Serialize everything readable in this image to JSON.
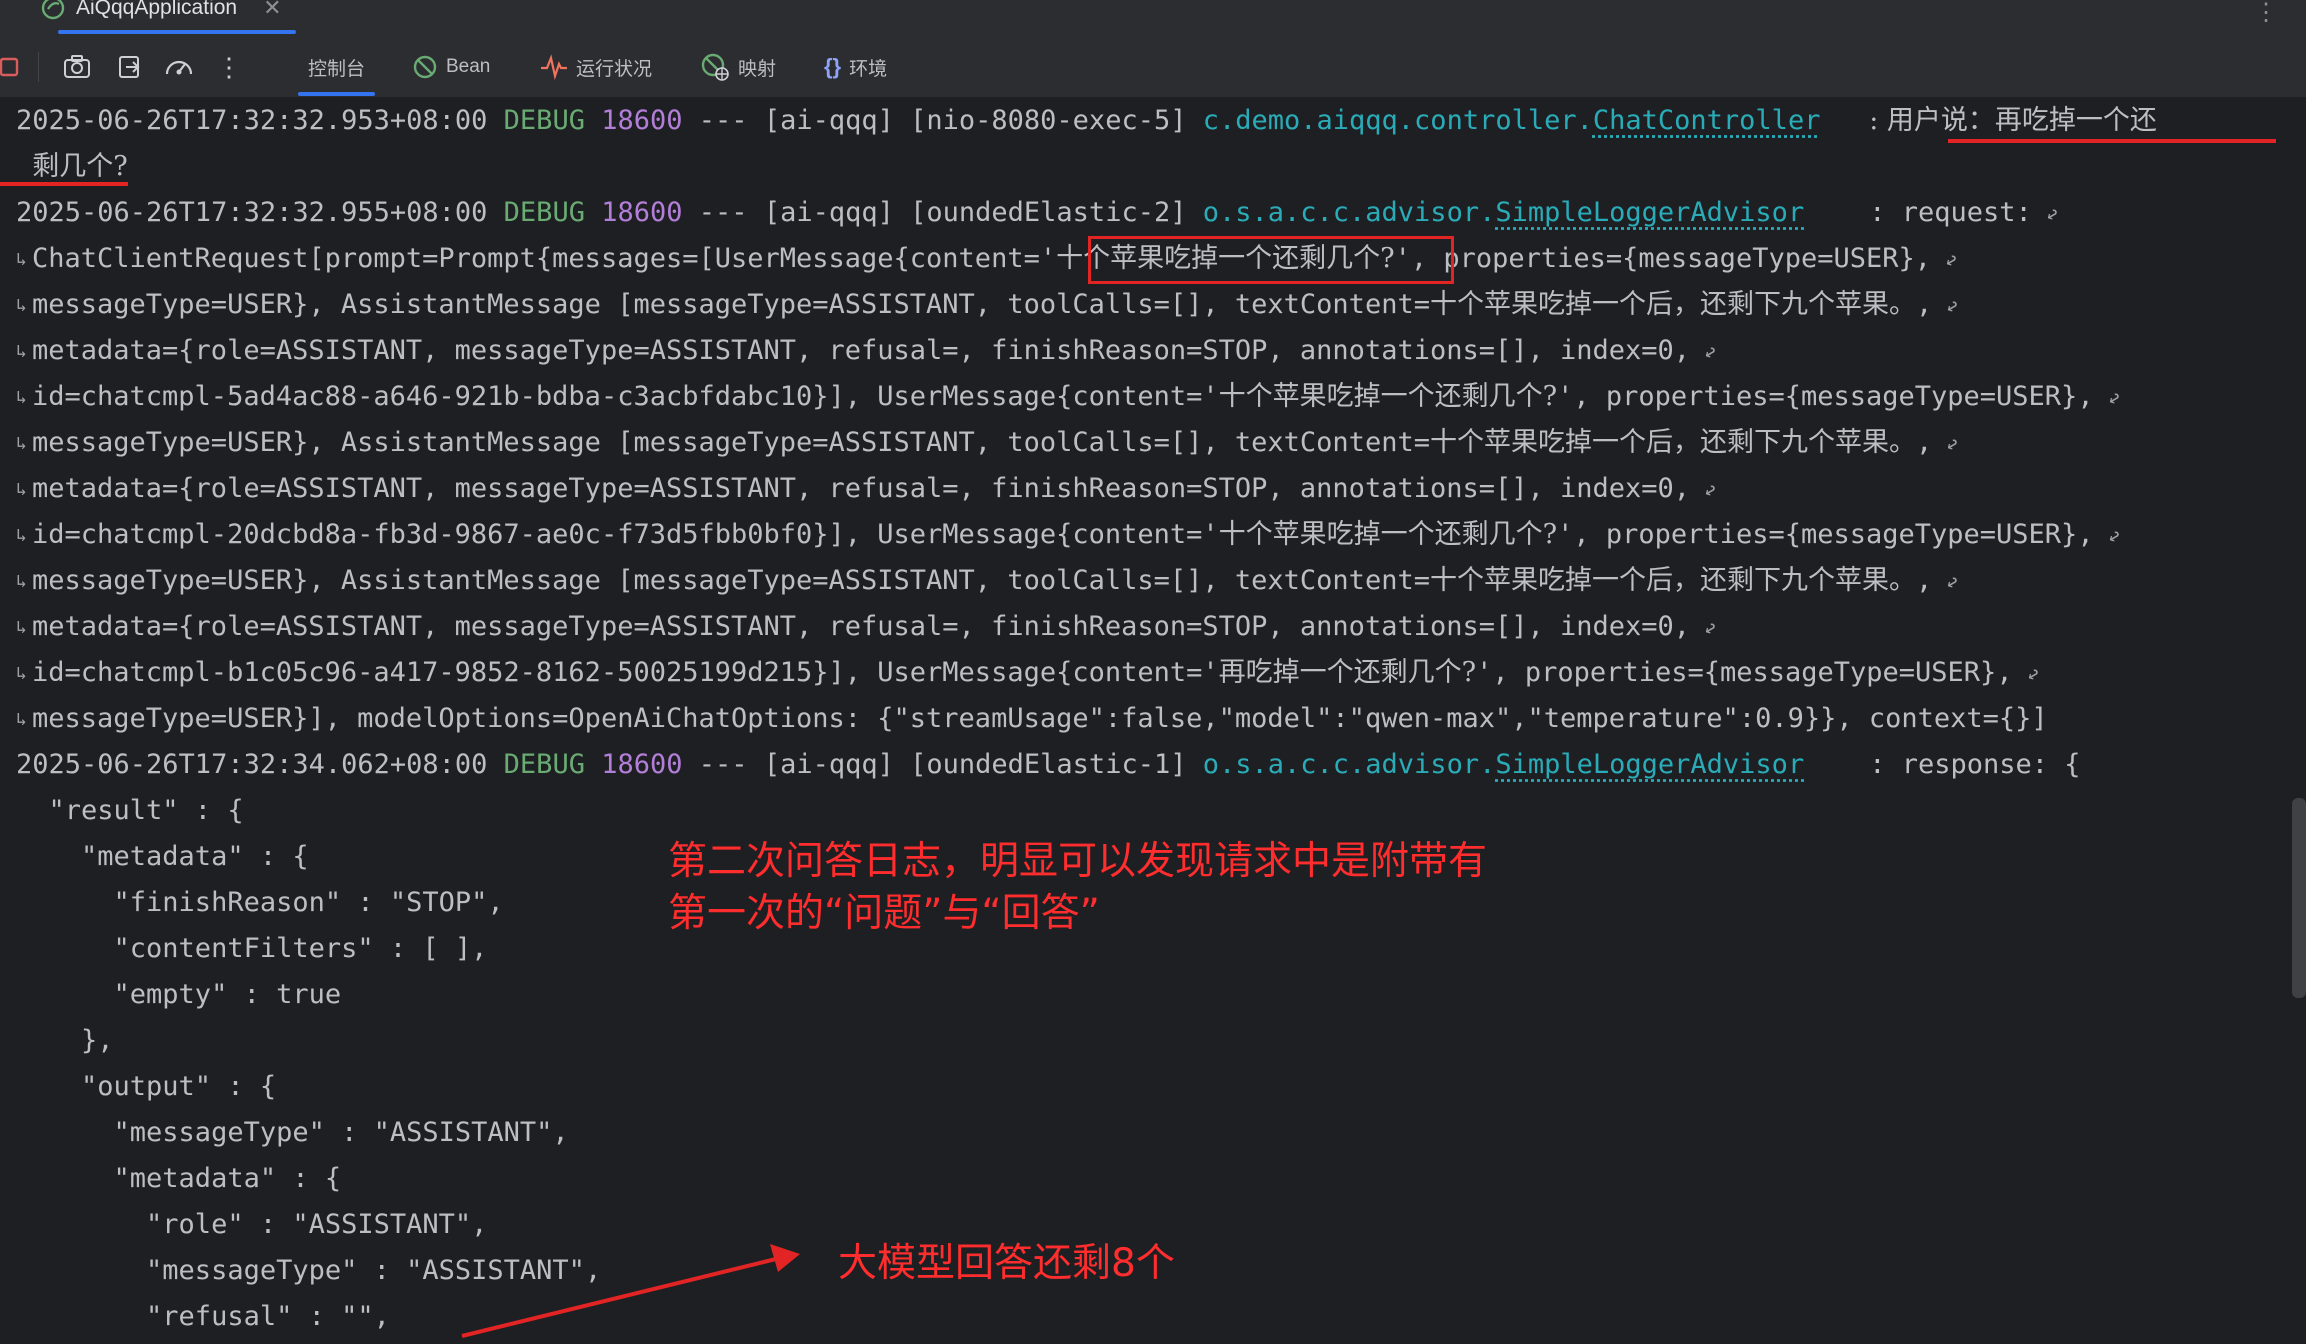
{
  "run_tab": {
    "title": "AiQqqApplication",
    "close": "✕"
  },
  "toolbar": {
    "tabs": [
      {
        "label": "控制台",
        "icon": "console-icon"
      },
      {
        "label": "Bean",
        "icon": "bean-icon"
      },
      {
        "label": "运行状况",
        "icon": "health-icon"
      },
      {
        "label": "映射",
        "icon": "mappings-icon"
      },
      {
        "label": "环境",
        "icon": "environment-icon"
      }
    ],
    "buttons": [
      "stop-icon",
      "camera-icon",
      "exit-icon",
      "speedometer-icon",
      "more-icon"
    ]
  },
  "colors": {
    "level": "#6aab73",
    "pid": "#b27ed8",
    "logger": "#2aacb8",
    "annotation": "#ff2d2d",
    "accent": "#3574f0"
  },
  "log": {
    "e1": {
      "ts": "2025-06-26T17:32:32.953+08:00",
      "level": "DEBUG",
      "pid": "18600",
      "sep": "---",
      "app": "[ai-qqq]",
      "thread": "[nio-8080-exec-5]",
      "pkg": "c.demo.aiqqq.controller.",
      "cls": "ChatController",
      "msg": ": 用户说：再吃掉一个还",
      "msg_cont": "剩几个?"
    },
    "e2": {
      "ts": "2025-06-26T17:32:32.955+08:00",
      "level": "DEBUG",
      "pid": "18600",
      "sep": "---",
      "app": "[ai-qqq]",
      "thread": "[oundedElastic-2]",
      "pkg": "o.s.a.c.c.advisor.",
      "cls": "SimpleLoggerAdvisor",
      "msg": ": request:",
      "l2a": "ChatClientRequest[prompt=Prompt{messages=[UserMessage{content='",
      "l2q": "十个苹果吃掉一个还剩几个?",
      "l2b": "', properties={messageType=USER},",
      "l3a": "messageType=USER}, AssistantMessage [messageType=ASSISTANT, toolCalls=[], textContent=",
      "l3b": "十个苹果吃掉一个后，还剩下九个苹果。",
      "l3c": ",",
      "l4": "metadata={role=ASSISTANT, messageType=ASSISTANT, refusal=, finishReason=STOP, annotations=[], index=0,",
      "l5a": "id=chatcmpl-5ad4ac88-a646-921b-bdba-c3acbfdabc10}], UserMessage{content='",
      "l5b": "十个苹果吃掉一个还剩几个?",
      "l5c": "', properties={messageType=USER},",
      "l6a": "messageType=USER}, AssistantMessage [messageType=ASSISTANT, toolCalls=[], textContent=",
      "l6b": "十个苹果吃掉一个后，还剩下九个苹果。",
      "l6c": ",",
      "l7": "metadata={role=ASSISTANT, messageType=ASSISTANT, refusal=, finishReason=STOP, annotations=[], index=0,",
      "l8a": "id=chatcmpl-20dcbd8a-fb3d-9867-ae0c-f73d5fbb0bf0}], UserMessage{content='",
      "l8b": "十个苹果吃掉一个还剩几个?",
      "l8c": "', properties={messageType=USER},",
      "l9a": "messageType=USER}, AssistantMessage [messageType=ASSISTANT, toolCalls=[], textContent=",
      "l9b": "十个苹果吃掉一个后，还剩下九个苹果。",
      "l9c": ",",
      "l10": "metadata={role=ASSISTANT, messageType=ASSISTANT, refusal=, finishReason=STOP, annotations=[], index=0,",
      "l11a": "id=chatcmpl-b1c05c96-a417-9852-8162-50025199d215}], UserMessage{content='",
      "l11b": "再吃掉一个还剩几个?",
      "l11c": "', properties={messageType=USER},",
      "l12": "messageType=USER}], modelOptions=OpenAiChatOptions: {\"streamUsage\":false,\"model\":\"qwen-max\",\"temperature\":0.9}}, context={}]"
    },
    "e3": {
      "ts": "2025-06-26T17:32:34.062+08:00",
      "level": "DEBUG",
      "pid": "18600",
      "sep": "---",
      "app": "[ai-qqq]",
      "thread": "[oundedElastic-1]",
      "pkg": "o.s.a.c.c.advisor.",
      "cls": "SimpleLoggerAdvisor",
      "msg": ": response: {"
    },
    "json_lines": [
      "  \"result\" : {",
      "    \"metadata\" : {",
      "      \"finishReason\" : \"STOP\",",
      "      \"contentFilters\" : [ ],",
      "      \"empty\" : true",
      "    },",
      "    \"output\" : {",
      "      \"messageType\" : \"ASSISTANT\",",
      "      \"metadata\" : {",
      "        \"role\" : \"ASSISTANT\",",
      "        \"messageType\" : \"ASSISTANT\",",
      "        \"refusal\" : \"\","
    ]
  },
  "annotations": {
    "note1_line1": "第二次问答日志，明显可以发现请求中是附带有",
    "note1_line2": "第一次的“问题”与“回答”",
    "note2": "大模型回答还剩8个"
  }
}
